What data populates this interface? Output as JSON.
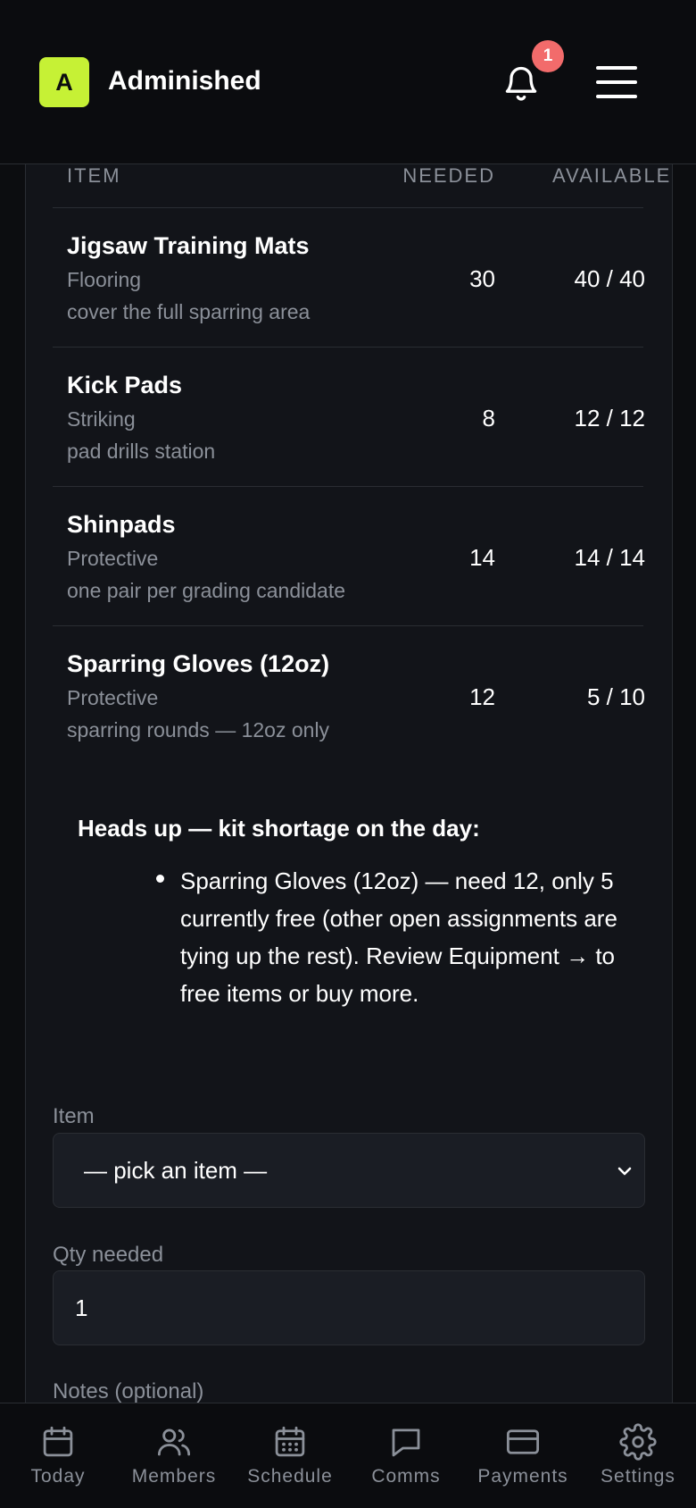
{
  "header": {
    "logo_letter": "A",
    "app_name": "Adminished",
    "notification_count": "1"
  },
  "table": {
    "columns": {
      "item": "ITEM",
      "needed": "NEEDED",
      "available": "AVAILABLE"
    },
    "rows": [
      {
        "name": "Jigsaw Training Mats",
        "category": "Flooring",
        "note": "cover the full sparring area",
        "needed": "30",
        "available": "40 / 40"
      },
      {
        "name": "Kick Pads",
        "category": "Striking",
        "note": "pad drills station",
        "needed": "8",
        "available": "12 / 12"
      },
      {
        "name": "Shinpads",
        "category": "Protective",
        "note": "one pair per grading candidate",
        "needed": "14",
        "available": "14 / 14"
      },
      {
        "name": "Sparring Gloves (12oz)",
        "category": "Protective",
        "note": "sparring rounds — 12oz only",
        "needed": "12",
        "available": "5 / 10"
      }
    ]
  },
  "alert": {
    "title": "Heads up — kit shortage on the day:",
    "items": [
      "Sparring Gloves (12oz) — need 12, only 5 currently free (other open assignments are tying up the rest). Review Equipment → to free items or buy more."
    ]
  },
  "form": {
    "item_label": "Item",
    "item_selected": "— pick an item —",
    "qty_label": "Qty needed",
    "qty_value": "1",
    "notes_label": "Notes (optional)"
  },
  "bottom_nav": [
    {
      "label": "Today",
      "icon": "calendar-icon"
    },
    {
      "label": "Members",
      "icon": "users-icon"
    },
    {
      "label": "Schedule",
      "icon": "calendar-grid-icon"
    },
    {
      "label": "Comms",
      "icon": "chat-bubble-icon"
    },
    {
      "label": "Payments",
      "icon": "credit-card-icon"
    },
    {
      "label": "Settings",
      "icon": "gear-icon"
    }
  ],
  "colors": {
    "brand_accent": "#c6f135",
    "badge": "#f26b6b",
    "background": "#0c0d10",
    "panel": "#121419",
    "muted_text": "#8b9099"
  }
}
